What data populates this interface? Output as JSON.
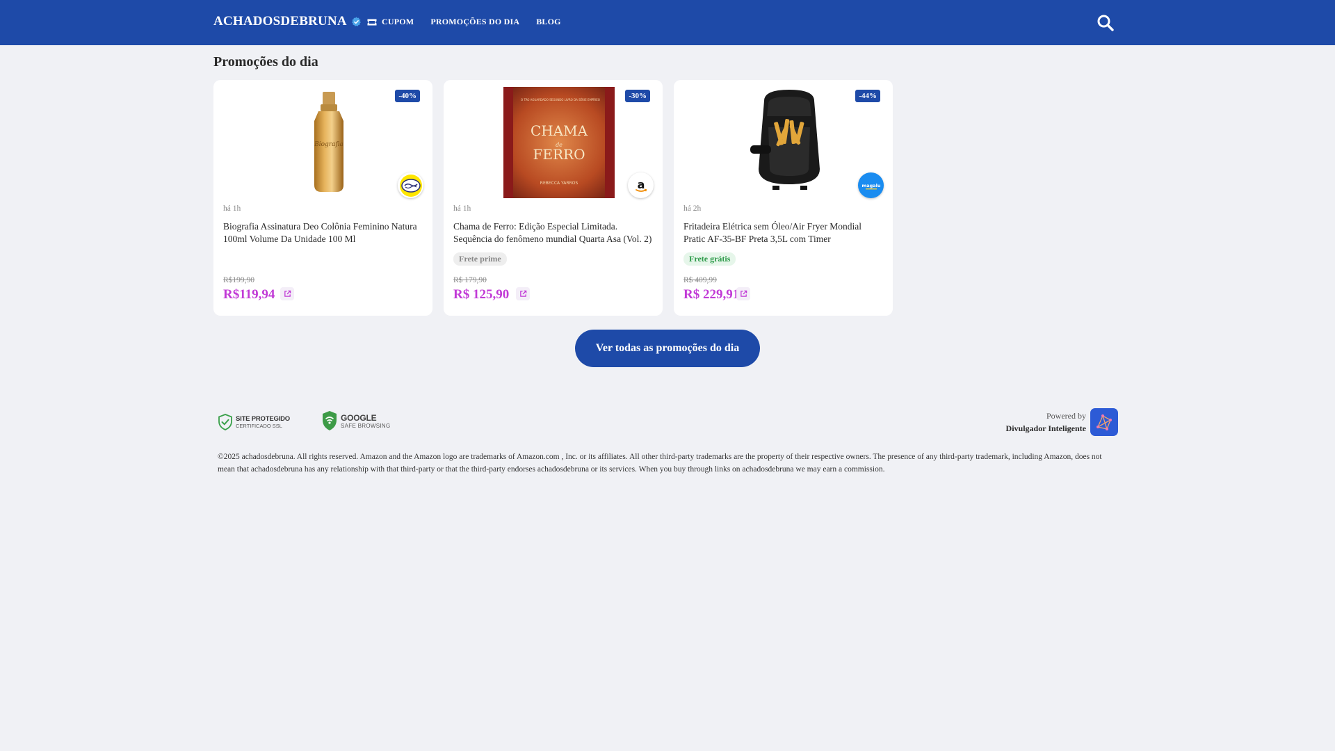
{
  "header": {
    "brand": "ACHADOSDEBRUNA",
    "nav": [
      {
        "label": "CUPOM",
        "icon": "ticket-icon"
      },
      {
        "label": "PROMOÇÕES DO DIA"
      },
      {
        "label": "BLOG"
      }
    ],
    "search_icon": "search-icon",
    "background": "#1e4aa8"
  },
  "section": {
    "title": "Promoções do dia"
  },
  "products": [
    {
      "discount": "-40%",
      "store": "mercado-livre",
      "time": "há 1h",
      "title": "Biografia Assinatura Deo Colônia Feminino Natura 100ml Volume Da Unidade 100 Ml",
      "shipping": "",
      "old_price": "R$199,90",
      "price": "R$119,94"
    },
    {
      "discount": "-30%",
      "store": "amazon",
      "time": "há 1h",
      "title": "Chama de Ferro: Edição Especial Limitada. Sequência do fenômeno mundial Quarta Asa (Vol. 2)",
      "shipping": "Frete prime",
      "old_price": "R$ 179,90",
      "price": "R$ 125,90",
      "cover_top": "O TÃO AGUARDADO SEGUNDO LIVRO DA SÉRIE EMPÍREO",
      "cover_title": "CHAMA de FERRO",
      "cover_author": "REBECCA YARROS"
    },
    {
      "discount": "-44%",
      "store": "magalu",
      "time": "há 2h",
      "title": "Fritadeira Elétrica sem Óleo/Air Fryer Mondial Pratic AF-35-BF Preta 3,5L com Timer",
      "shipping": "Frete grátis",
      "old_price": "R$ 409,99",
      "price": "R$ 229,91"
    }
  ],
  "cta": {
    "label": "Ver todas as promoções do dia"
  },
  "seals": {
    "ssl_big": "SITE PROTEGIDO",
    "ssl_small": "CERTIFICADO SSL",
    "google_big": "GOOGLE",
    "google_small": "SAFE BROWSING"
  },
  "powered": {
    "by": "Powered by",
    "name": "Divulgador Inteligente"
  },
  "footer": {
    "text": "©2025 achadosdebruna. All rights reserved. Amazon and the Amazon logo are trademarks of Amazon.com , Inc. or its affiliates. All other third-party trademarks are the property of their respective owners. The presence of any third-party trademark, including Amazon, does not mean that achadosdebruna has any relationship with that third-party or that the third-party endorses achadosdebruna or its services. When you buy through links on achadosdebruna we may earn a commission."
  },
  "colors": {
    "primary": "#1e4aa8",
    "price": "#c13ad6",
    "page_bg": "#f0f1f5"
  }
}
